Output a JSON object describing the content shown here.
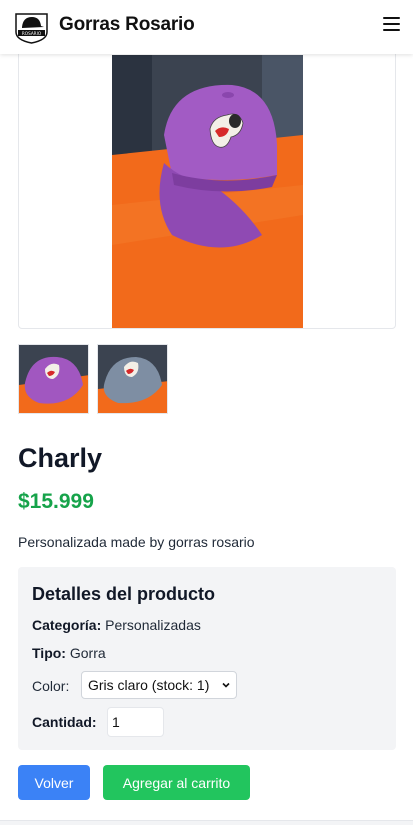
{
  "header": {
    "brand": "Gorras Rosario",
    "logo_icon": "cap-logo-icon",
    "logo_text": "ROSARIO",
    "menu_icon": "hamburger-menu-icon"
  },
  "product": {
    "name": "Charly",
    "price": "$15.999",
    "description": "Personalizada made by gorras rosario",
    "images": [
      {
        "name": "purple-cap",
        "color": "#a157c0"
      },
      {
        "name": "gray-cap",
        "color": "#7e8ea3"
      }
    ]
  },
  "details": {
    "title": "Detalles del producto",
    "category_label": "Categoría:",
    "category_value": "Personalizadas",
    "type_label": "Tipo:",
    "type_value": "Gorra",
    "color_label": "Color:",
    "color_selected": "Gris claro (stock: 1)",
    "quantity_label": "Cantidad:",
    "quantity_value": "1"
  },
  "actions": {
    "back_label": "Volver",
    "cart_label": "Agregar al carrito"
  },
  "colors": {
    "price": "#16a34a",
    "back_button": "#3b82f6",
    "cart_button": "#22c55e",
    "details_bg": "#f3f4f6"
  }
}
